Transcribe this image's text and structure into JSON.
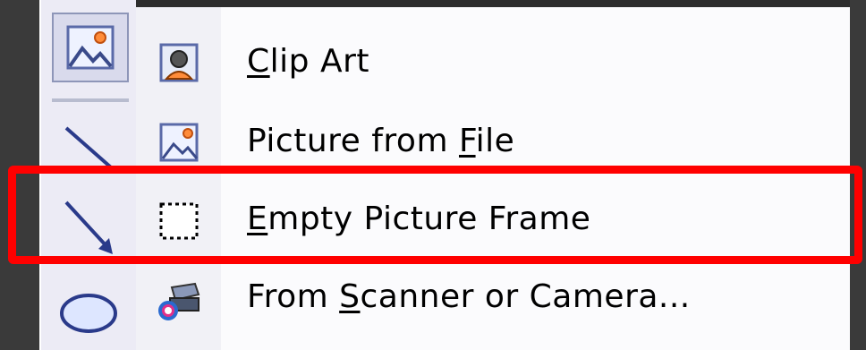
{
  "menu": {
    "items": [
      {
        "pre": "",
        "accel": "C",
        "post": "lip Art",
        "icon": "clip-art-icon"
      },
      {
        "pre": "Picture from ",
        "accel": "F",
        "post": "ile",
        "icon": "picture-file-icon"
      },
      {
        "pre": "",
        "accel": "E",
        "post": "mpty Picture Frame",
        "icon": "empty-frame-icon"
      },
      {
        "pre": "From ",
        "accel": "S",
        "post": "canner or Camera...",
        "icon": "scanner-icon"
      }
    ]
  },
  "toolbar": {
    "buttons": [
      "insert-picture-icon",
      "line-icon",
      "arrow-icon",
      "oval-icon"
    ]
  },
  "colors": {
    "highlight": "#ff0000",
    "menu_bg": "#fbfbfd",
    "toolbar_bg": "#ecebf5"
  }
}
